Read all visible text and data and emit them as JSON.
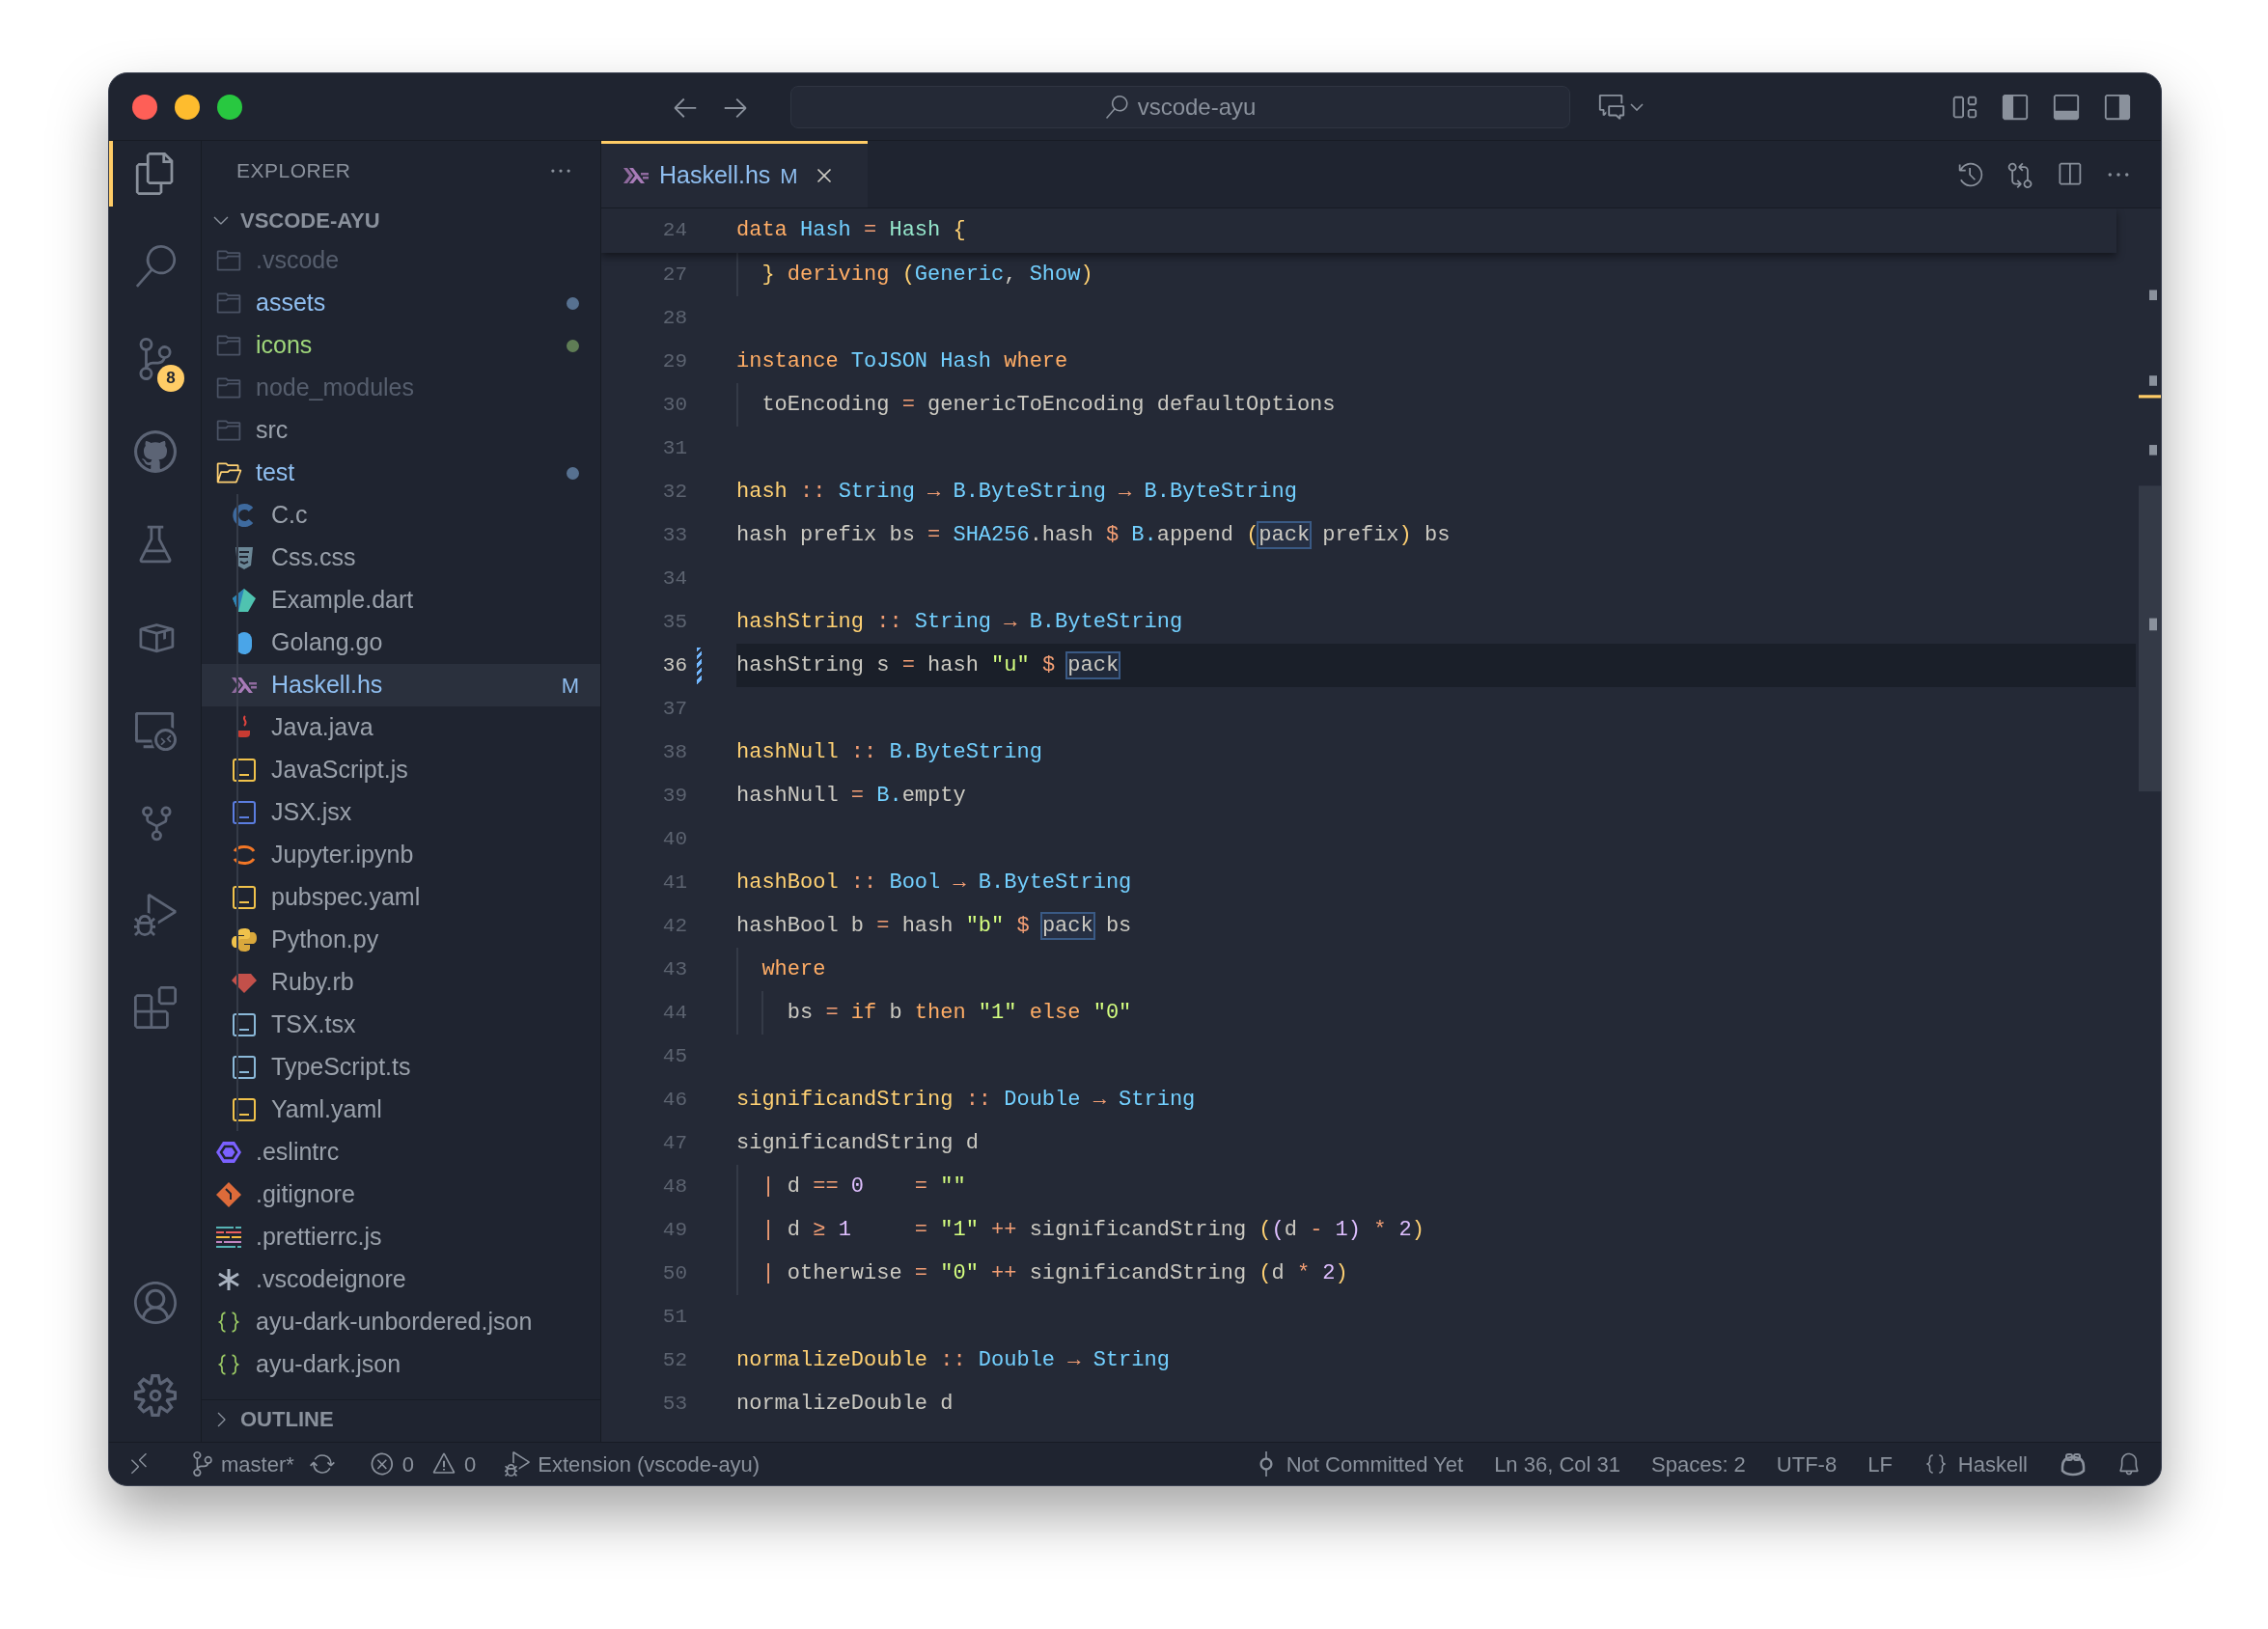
{
  "title_bar": {
    "search": "vscode-ayu"
  },
  "activity_bar": [
    {
      "kind": "files",
      "selected": true
    },
    {
      "kind": "search",
      "selected": false
    },
    {
      "kind": "git",
      "selected": false,
      "badge": "8"
    },
    {
      "kind": "github",
      "selected": false
    },
    {
      "kind": "testing",
      "selected": false
    },
    {
      "kind": "package",
      "selected": false
    },
    {
      "kind": "remote",
      "selected": false
    },
    {
      "kind": "tree",
      "selected": false
    },
    {
      "kind": "debug",
      "selected": false
    },
    {
      "kind": "extensions",
      "selected": false
    }
  ],
  "activity_bottom": [
    {
      "kind": "account"
    },
    {
      "kind": "settings"
    }
  ],
  "explorer": {
    "title": "EXPLORER",
    "root": {
      "label": "VSCODE-AYU",
      "expanded": true,
      "children": [
        {
          "name": ".vscode",
          "kind": "folder",
          "color": "#565e6d",
          "dot": false,
          "expanded": false,
          "selected": false
        },
        {
          "name": "assets",
          "kind": "folder",
          "color": "#8fbef0",
          "dot": true,
          "expanded": false,
          "selected": false
        },
        {
          "name": "icons",
          "kind": "folder",
          "color": "#9fd67a",
          "dot": true,
          "expanded": false,
          "selected": false
        },
        {
          "name": "node_modules",
          "kind": "folder",
          "color": "#565e6d",
          "dot": false,
          "expanded": false,
          "selected": false
        },
        {
          "name": "src",
          "kind": "folder",
          "color": "#9aa1ab",
          "dot": false,
          "expanded": false,
          "selected": false
        },
        {
          "name": "test",
          "kind": "folder",
          "color": "#8fbef0",
          "dot": true,
          "expanded": true,
          "selected": false,
          "children": [
            {
              "name": "C.c",
              "kind": "c",
              "color": "#9aa1ab",
              "dot": false,
              "selected": false
            },
            {
              "name": "Css.css",
              "kind": "css",
              "color": "#9aa1ab",
              "dot": false,
              "selected": false
            },
            {
              "name": "Example.dart",
              "kind": "dart",
              "color": "#9aa1ab",
              "dot": false,
              "selected": false
            },
            {
              "name": "Golang.go",
              "kind": "go",
              "color": "#9aa1ab",
              "dot": false,
              "selected": false
            },
            {
              "name": "Haskell.hs",
              "kind": "haskell",
              "color": "#8fbef0",
              "dot": false,
              "badge": "M",
              "selected": true
            },
            {
              "name": "Java.java",
              "kind": "java",
              "color": "#9aa1ab",
              "dot": false,
              "selected": false
            },
            {
              "name": "JavaScript.js",
              "kind": "js",
              "color": "#9aa1ab",
              "dot": false,
              "selected": false
            },
            {
              "name": "JSX.jsx",
              "kind": "jsx",
              "color": "#9aa1ab",
              "dot": false,
              "selected": false
            },
            {
              "name": "Jupyter.ipynb",
              "kind": "jupyter",
              "color": "#9aa1ab",
              "dot": false,
              "selected": false
            },
            {
              "name": "pubspec.yaml",
              "kind": "yaml",
              "color": "#9aa1ab",
              "dot": false,
              "selected": false
            },
            {
              "name": "Python.py",
              "kind": "python",
              "color": "#9aa1ab",
              "dot": false,
              "selected": false
            },
            {
              "name": "Ruby.rb",
              "kind": "ruby",
              "color": "#9aa1ab",
              "dot": false,
              "selected": false
            },
            {
              "name": "TSX.tsx",
              "kind": "ts",
              "color": "#9aa1ab",
              "dot": false,
              "selected": false
            },
            {
              "name": "TypeScript.ts",
              "kind": "ts",
              "color": "#9aa1ab",
              "dot": false,
              "selected": false
            },
            {
              "name": "Yaml.yaml",
              "kind": "yaml",
              "color": "#9aa1ab",
              "dot": false,
              "selected": false
            }
          ]
        },
        {
          "name": ".eslintrc",
          "kind": "eslint",
          "color": "#9aa1ab",
          "dot": false,
          "selected": false
        },
        {
          "name": ".gitignore",
          "kind": "git",
          "color": "#9aa1ab",
          "dot": false,
          "selected": false
        },
        {
          "name": ".prettierrc.js",
          "kind": "prettier",
          "color": "#9aa1ab",
          "dot": false,
          "selected": false
        },
        {
          "name": ".vscodeignore",
          "kind": "asterisk",
          "color": "#9aa1ab",
          "dot": false,
          "selected": false
        },
        {
          "name": "ayu-dark-unbordered.json",
          "kind": "json",
          "color": "#9aa1ab",
          "dot": false,
          "selected": false
        },
        {
          "name": "ayu-dark.json",
          "kind": "json",
          "color": "#9aa1ab",
          "dot": false,
          "selected": false
        }
      ]
    },
    "outline": {
      "label": "OUTLINE",
      "expanded": false
    }
  },
  "tab": {
    "label": "Haskell.hs",
    "badge": "M",
    "selected": true
  },
  "sticky_line": {
    "number": "24",
    "tokens": [
      {
        "kind": "kw",
        "text": "data "
      },
      {
        "kind": "type",
        "text": "Hash "
      },
      {
        "kind": "op",
        "text": "= "
      },
      {
        "kind": "ctor",
        "text": "Hash "
      },
      {
        "kind": "bracket",
        "text": "{"
      }
    ]
  },
  "lines": [
    {
      "number": "27",
      "current": false,
      "changed": false,
      "tokens": [
        {
          "kind": "bracket",
          "text": "  } "
        },
        {
          "kind": "kw",
          "text": "deriving "
        },
        {
          "kind": "bracket",
          "text": "("
        },
        {
          "kind": "type",
          "text": "Generic"
        },
        {
          "kind": "plain",
          "text": ", "
        },
        {
          "kind": "type",
          "text": "Show"
        },
        {
          "kind": "bracket",
          "text": ")"
        }
      ]
    },
    {
      "number": "28",
      "current": false,
      "changed": false
    },
    {
      "number": "29",
      "current": false,
      "changed": false,
      "tokens": [
        {
          "kind": "kw",
          "text": "instance "
        },
        {
          "kind": "type",
          "text": "ToJSON Hash "
        },
        {
          "kind": "kw",
          "text": "where"
        }
      ]
    },
    {
      "number": "30",
      "current": false,
      "changed": false,
      "tokens": [
        {
          "kind": "plain",
          "text": "  toEncoding "
        },
        {
          "kind": "op",
          "text": "= "
        },
        {
          "kind": "plain",
          "text": "genericToEncoding defaultOptions"
        }
      ]
    },
    {
      "number": "31",
      "current": false,
      "changed": false
    },
    {
      "number": "32",
      "current": false,
      "changed": false,
      "tokens": [
        {
          "kind": "func",
          "text": "hash "
        },
        {
          "kind": "op",
          "text": ":: "
        },
        {
          "kind": "type",
          "text": "String "
        },
        {
          "kind": "op",
          "text": "→ "
        },
        {
          "kind": "type",
          "text": "B.ByteString "
        },
        {
          "kind": "op",
          "text": "→ "
        },
        {
          "kind": "type",
          "text": "B.ByteString"
        }
      ]
    },
    {
      "number": "33",
      "current": false,
      "changed": false,
      "tokens": [
        {
          "kind": "plain",
          "text": "hash prefix bs "
        },
        {
          "kind": "op",
          "text": "= "
        },
        {
          "kind": "type",
          "text": "SHA256"
        },
        {
          "kind": "plain",
          "text": ".hash "
        },
        {
          "kind": "op",
          "text": "$ "
        },
        {
          "kind": "type",
          "text": "B."
        },
        {
          "kind": "plain",
          "text": "append "
        },
        {
          "kind": "bracket",
          "text": "("
        },
        {
          "kind": "boxed",
          "text": "pack"
        },
        {
          "kind": "plain",
          "text": " prefix"
        },
        {
          "kind": "bracket",
          "text": ")"
        },
        {
          "kind": "plain",
          "text": " bs"
        }
      ]
    },
    {
      "number": "34",
      "current": false,
      "changed": false
    },
    {
      "number": "35",
      "current": false,
      "changed": false,
      "tokens": [
        {
          "kind": "func",
          "text": "hashString "
        },
        {
          "kind": "op",
          "text": ":: "
        },
        {
          "kind": "type",
          "text": "String "
        },
        {
          "kind": "op",
          "text": "→ "
        },
        {
          "kind": "type",
          "text": "B.ByteString"
        }
      ]
    },
    {
      "number": "36",
      "current": true,
      "changed": true,
      "tokens": [
        {
          "kind": "plain",
          "text": "hashString s "
        },
        {
          "kind": "op",
          "text": "= "
        },
        {
          "kind": "plain",
          "text": "hash "
        },
        {
          "kind": "str",
          "text": "\"u\" "
        },
        {
          "kind": "op",
          "text": "$ "
        },
        {
          "kind": "boxed",
          "text": "pack"
        }
      ]
    },
    {
      "number": "37",
      "current": false,
      "changed": false
    },
    {
      "number": "38",
      "current": false,
      "changed": false,
      "tokens": [
        {
          "kind": "func",
          "text": "hashNull "
        },
        {
          "kind": "op",
          "text": ":: "
        },
        {
          "kind": "type",
          "text": "B.ByteString"
        }
      ]
    },
    {
      "number": "39",
      "current": false,
      "changed": false,
      "tokens": [
        {
          "kind": "plain",
          "text": "hashNull "
        },
        {
          "kind": "op",
          "text": "= "
        },
        {
          "kind": "type",
          "text": "B."
        },
        {
          "kind": "plain",
          "text": "empty"
        }
      ]
    },
    {
      "number": "40",
      "current": false,
      "changed": false
    },
    {
      "number": "41",
      "current": false,
      "changed": false,
      "tokens": [
        {
          "kind": "func",
          "text": "hashBool "
        },
        {
          "kind": "op",
          "text": ":: "
        },
        {
          "kind": "type",
          "text": "Bool "
        },
        {
          "kind": "op",
          "text": "→ "
        },
        {
          "kind": "type",
          "text": "B.ByteString"
        }
      ]
    },
    {
      "number": "42",
      "current": false,
      "changed": false,
      "tokens": [
        {
          "kind": "plain",
          "text": "hashBool b "
        },
        {
          "kind": "op",
          "text": "= "
        },
        {
          "kind": "plain",
          "text": "hash "
        },
        {
          "kind": "str",
          "text": "\"b\" "
        },
        {
          "kind": "op",
          "text": "$ "
        },
        {
          "kind": "boxed",
          "text": "pack"
        },
        {
          "kind": "plain",
          "text": " bs"
        }
      ]
    },
    {
      "number": "43",
      "current": false,
      "changed": false,
      "tokens": [
        {
          "kind": "kw",
          "text": "  where"
        }
      ]
    },
    {
      "number": "44",
      "current": false,
      "changed": false,
      "tokens": [
        {
          "kind": "plain",
          "text": "    bs "
        },
        {
          "kind": "op",
          "text": "= "
        },
        {
          "kind": "kw",
          "text": "if "
        },
        {
          "kind": "plain",
          "text": "b "
        },
        {
          "kind": "kw",
          "text": "then "
        },
        {
          "kind": "str",
          "text": "\"1\" "
        },
        {
          "kind": "kw",
          "text": "else "
        },
        {
          "kind": "str",
          "text": "\"0\""
        }
      ]
    },
    {
      "number": "45",
      "current": false,
      "changed": false
    },
    {
      "number": "46",
      "current": false,
      "changed": false,
      "tokens": [
        {
          "kind": "func",
          "text": "significandString "
        },
        {
          "kind": "op",
          "text": ":: "
        },
        {
          "kind": "type",
          "text": "Double "
        },
        {
          "kind": "op",
          "text": "→ "
        },
        {
          "kind": "type",
          "text": "String"
        }
      ]
    },
    {
      "number": "47",
      "current": false,
      "changed": false,
      "tokens": [
        {
          "kind": "plain",
          "text": "significandString d"
        }
      ]
    },
    {
      "number": "48",
      "current": false,
      "changed": false,
      "tokens": [
        {
          "kind": "op",
          "text": "  | "
        },
        {
          "kind": "plain",
          "text": "d "
        },
        {
          "kind": "op",
          "text": "== "
        },
        {
          "kind": "num",
          "text": "0    "
        },
        {
          "kind": "op",
          "text": "= "
        },
        {
          "kind": "str",
          "text": "\"\""
        }
      ]
    },
    {
      "number": "49",
      "current": false,
      "changed": false,
      "tokens": [
        {
          "kind": "op",
          "text": "  | "
        },
        {
          "kind": "plain",
          "text": "d "
        },
        {
          "kind": "op",
          "text": "≥ "
        },
        {
          "kind": "num",
          "text": "1     "
        },
        {
          "kind": "op",
          "text": "= "
        },
        {
          "kind": "str",
          "text": "\"1\" "
        },
        {
          "kind": "op",
          "text": "++ "
        },
        {
          "kind": "plain",
          "text": "significandString "
        },
        {
          "kind": "bracket",
          "text": "("
        },
        {
          "kind": "bracket2",
          "text": "("
        },
        {
          "kind": "plain",
          "text": "d "
        },
        {
          "kind": "op",
          "text": "- "
        },
        {
          "kind": "num",
          "text": "1"
        },
        {
          "kind": "bracket2",
          "text": ") "
        },
        {
          "kind": "op",
          "text": "* "
        },
        {
          "kind": "num",
          "text": "2"
        },
        {
          "kind": "bracket",
          "text": ")"
        }
      ]
    },
    {
      "number": "50",
      "current": false,
      "changed": false,
      "tokens": [
        {
          "kind": "op",
          "text": "  | "
        },
        {
          "kind": "plain",
          "text": "otherwise "
        },
        {
          "kind": "op",
          "text": "= "
        },
        {
          "kind": "str",
          "text": "\"0\" "
        },
        {
          "kind": "op",
          "text": "++ "
        },
        {
          "kind": "plain",
          "text": "significandString "
        },
        {
          "kind": "bracket",
          "text": "("
        },
        {
          "kind": "plain",
          "text": "d "
        },
        {
          "kind": "op",
          "text": "* "
        },
        {
          "kind": "num",
          "text": "2"
        },
        {
          "kind": "bracket",
          "text": ")"
        }
      ]
    },
    {
      "number": "51",
      "current": false,
      "changed": false
    },
    {
      "number": "52",
      "current": false,
      "changed": false,
      "tokens": [
        {
          "kind": "func",
          "text": "normalizeDouble "
        },
        {
          "kind": "op",
          "text": ":: "
        },
        {
          "kind": "type",
          "text": "Double "
        },
        {
          "kind": "op",
          "text": "→ "
        },
        {
          "kind": "type",
          "text": "String"
        }
      ]
    },
    {
      "number": "53",
      "current": false,
      "changed": false,
      "tokens": [
        {
          "kind": "plain",
          "text": "normalizeDouble d"
        }
      ]
    }
  ],
  "status_bar": {
    "branch": "master*",
    "errors": "0",
    "warnings": "0",
    "task": "Extension (vscode-ayu)",
    "blame": "Not Committed Yet",
    "position": "Ln 36, Col 31",
    "indentation": "Spaces: 2",
    "encoding": "UTF-8",
    "eol": "LF",
    "language": "Haskell"
  }
}
